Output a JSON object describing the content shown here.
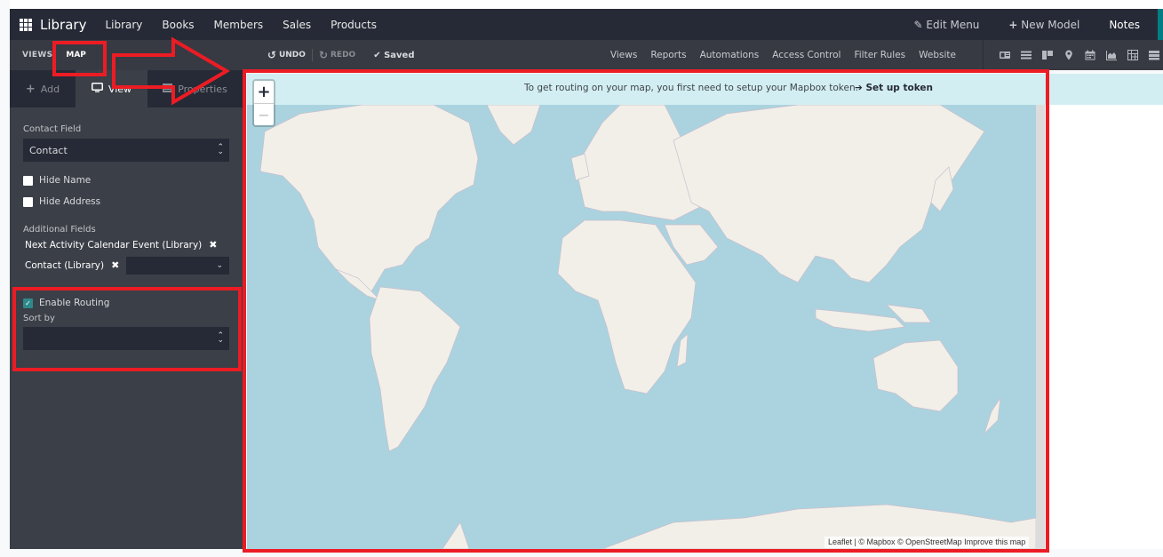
{
  "navbar": {
    "apps_icon": "grid-icon",
    "brand": "Library",
    "menu": [
      "Library",
      "Books",
      "Members",
      "Sales",
      "Products"
    ],
    "edit_menu": "Edit Menu",
    "new_model": "New Model",
    "notes": "Notes"
  },
  "toolbar": {
    "views_label": "VIEWS",
    "current_view": "MAP",
    "undo": "UNDO",
    "redo": "REDO",
    "saved": "Saved",
    "menu": [
      "Views",
      "Reports",
      "Automations",
      "Access Control",
      "Filter Rules",
      "Website"
    ],
    "view_icons": [
      "form-view-icon",
      "list-view-icon",
      "kanban-view-icon",
      "map-view-icon",
      "calendar-view-icon",
      "graph-view-icon",
      "pivot-view-icon",
      "activity-view-icon"
    ]
  },
  "sidebar": {
    "tabs": [
      {
        "label": "Add",
        "icon": "plus-icon"
      },
      {
        "label": "View",
        "icon": "monitor-icon",
        "active": true
      },
      {
        "label": "Properties",
        "icon": "properties-icon"
      }
    ],
    "contact_field_label": "Contact Field",
    "contact_field_value": "Contact",
    "hide_name": {
      "label": "Hide Name",
      "checked": false
    },
    "hide_address": {
      "label": "Hide Address",
      "checked": false
    },
    "additional_fields_label": "Additional Fields",
    "additional_fields": [
      "Next Activity Calendar Event (Library)",
      "Contact (Library)"
    ],
    "enable_routing": {
      "label": "Enable Routing",
      "checked": true
    },
    "sort_by_label": "Sort by",
    "sort_by_value": ""
  },
  "map": {
    "notice_text": "To get routing on your map, you first need to setup your Mapbox token.",
    "notice_link": "Set up token",
    "zoom_in": "+",
    "zoom_out": "−",
    "attribution": "Leaflet | © Mapbox © OpenStreetMap Improve this map",
    "colors": {
      "ocean": "#aad3df",
      "land": "#f2efe9",
      "border": "#c5b9c9"
    }
  },
  "annotations": {
    "color": "#ec1c24"
  }
}
